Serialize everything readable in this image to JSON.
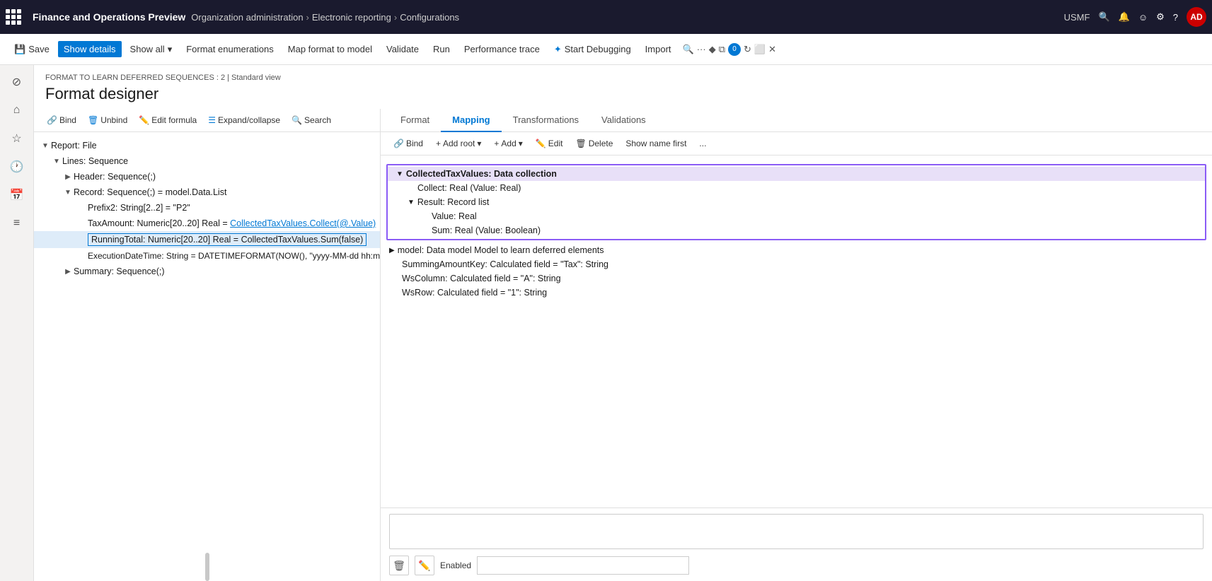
{
  "app": {
    "title": "Finance and Operations Preview"
  },
  "breadcrumb": {
    "items": [
      "Organization administration",
      "Electronic reporting",
      "Configurations"
    ]
  },
  "topnav": {
    "region": "USMF",
    "user": "AD"
  },
  "commandbar": {
    "save": "Save",
    "show_details": "Show details",
    "show_all": "Show all",
    "format_enumerations": "Format enumerations",
    "map_format": "Map format to model",
    "validate": "Validate",
    "run": "Run",
    "performance_trace": "Performance trace",
    "start_debugging": "Start Debugging",
    "import": "Import"
  },
  "page": {
    "breadcrumb": "FORMAT TO LEARN DEFERRED SEQUENCES : 2  |  Standard view",
    "title": "Format designer"
  },
  "left_panel": {
    "toolbar": {
      "bind": "Bind",
      "unbind": "Unbind",
      "edit_formula": "Edit formula",
      "expand_collapse": "Expand/collapse",
      "search": "Search"
    },
    "tree": [
      {
        "id": "report",
        "label": "Report: File",
        "level": 0,
        "toggle": "▼",
        "selected": false
      },
      {
        "id": "lines",
        "label": "Lines: Sequence",
        "level": 1,
        "toggle": "▼",
        "selected": false
      },
      {
        "id": "header",
        "label": "Header: Sequence(;)",
        "level": 2,
        "toggle": "▶",
        "selected": false
      },
      {
        "id": "record",
        "label": "Record: Sequence(;) = model.Data.List",
        "level": 2,
        "toggle": "▼",
        "selected": false
      },
      {
        "id": "prefix2",
        "label": "Prefix2: String[2..2] = \"P2\"",
        "level": 3,
        "toggle": "",
        "selected": false
      },
      {
        "id": "taxamount",
        "label": "TaxAmount: Numeric[20..20] Real = CollectedTaxValues.Collect(@.Value)",
        "level": 3,
        "toggle": "",
        "selected": false,
        "underline": true
      },
      {
        "id": "runningtotal",
        "label": "RunningTotal: Numeric[20..20] Real = CollectedTaxValues.Sum(false)",
        "level": 3,
        "toggle": "",
        "selected": true
      },
      {
        "id": "executiondatetime",
        "label": "ExecutionDateTime: String = DATETIMEFORMAT(NOW(), \"yyyy-MM-dd hh:mm:ss:fff\")",
        "level": 3,
        "toggle": "",
        "selected": false
      },
      {
        "id": "summary",
        "label": "Summary: Sequence(;)",
        "level": 2,
        "toggle": "▶",
        "selected": false
      }
    ]
  },
  "right_panel": {
    "tabs": [
      "Format",
      "Mapping",
      "Transformations",
      "Validations"
    ],
    "active_tab": "Mapping",
    "toolbar": {
      "bind": "Bind",
      "add_root": "Add root",
      "add": "Add",
      "edit": "Edit",
      "delete": "Delete",
      "show_name_first": "Show name first",
      "more": "..."
    },
    "datasources": [
      {
        "id": "collected",
        "label": "CollectedTaxValues: Data collection",
        "level": 0,
        "toggle": "▼",
        "highlighted": true
      },
      {
        "id": "collect",
        "label": "Collect: Real (Value: Real)",
        "level": 1,
        "toggle": "",
        "highlighted": true
      },
      {
        "id": "result",
        "label": "Result: Record list",
        "level": 1,
        "toggle": "▼",
        "highlighted": true
      },
      {
        "id": "value",
        "label": "Value: Real",
        "level": 2,
        "toggle": "",
        "highlighted": true
      },
      {
        "id": "sum",
        "label": "Sum: Real (Value: Boolean)",
        "level": 2,
        "toggle": "",
        "highlighted": true
      },
      {
        "id": "model",
        "label": "model: Data model Model to learn deferred elements",
        "level": 0,
        "toggle": "▶",
        "highlighted": false
      },
      {
        "id": "summingkey",
        "label": "SummingAmountKey: Calculated field = \"Tax\": String",
        "level": 0,
        "toggle": "",
        "highlighted": false
      },
      {
        "id": "wscolumn",
        "label": "WsColumn: Calculated field = \"A\": String",
        "level": 0,
        "toggle": "",
        "highlighted": false
      },
      {
        "id": "wsrow",
        "label": "WsRow: Calculated field = \"1\": String",
        "level": 0,
        "toggle": "",
        "highlighted": false
      }
    ],
    "formula_area": {
      "formula_value": "",
      "enabled_label": "Enabled",
      "enabled_value": ""
    }
  },
  "icons": {
    "save": "💾",
    "filter": "⊘",
    "bind": "🔗",
    "unbind": "🗑",
    "edit": "✏️",
    "expand": "☰",
    "search": "🔍",
    "add": "+",
    "delete": "🗑",
    "chevron_down": "▾",
    "chevron_right": "▶",
    "chevron_left": "◀",
    "home": "⌂",
    "star": "☆",
    "clock": "🕐",
    "calendar": "📅",
    "list": "≡",
    "bell": "🔔",
    "smiley": "☺",
    "gear": "⚙",
    "help": "?",
    "search_top": "🔍",
    "more": "···",
    "diamond": "◆",
    "copy": "⧉",
    "counter": "0",
    "refresh": "↻",
    "maximize": "⬜",
    "close": "✕",
    "dots": "···"
  }
}
